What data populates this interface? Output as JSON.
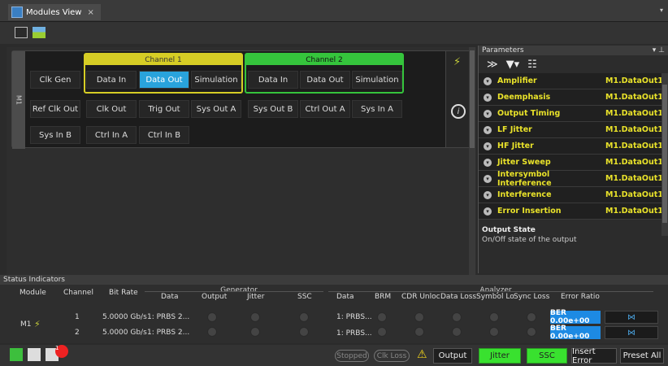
{
  "tab": {
    "title": "Modules View",
    "close": "×"
  },
  "module": {
    "label": "M1",
    "channel1": {
      "title": "Channel 1"
    },
    "channel2": {
      "title": "Channel 2"
    },
    "cells": [
      "Clk Gen",
      "Data In",
      "Data Out",
      "Simulation",
      "Data In",
      "Data Out",
      "Simulation",
      "Ref Clk Out",
      "Clk Out",
      "Trig Out",
      "Sys Out A",
      "Sys Out B",
      "Ctrl Out A",
      "Sys In A",
      "Sys In B",
      "Ctrl In A",
      "Ctrl In B"
    ],
    "info": "i"
  },
  "parameters": {
    "title": "Parameters",
    "rows": [
      {
        "name": "Amplifier",
        "value": "M1.DataOut1"
      },
      {
        "name": "Deemphasis",
        "value": "M1.DataOut1"
      },
      {
        "name": "Output Timing",
        "value": "M1.DataOut1"
      },
      {
        "name": "LF Jitter",
        "value": "M1.DataOut1"
      },
      {
        "name": "HF Jitter",
        "value": "M1.DataOut1"
      },
      {
        "name": "Jitter Sweep",
        "value": "M1.DataOut1"
      },
      {
        "name": "Intersymbol Interference",
        "value": "M1.DataOut1"
      },
      {
        "name": "Interference",
        "value": "M1.DataOut1"
      },
      {
        "name": "Error Insertion",
        "value": "M1.DataOut1"
      }
    ],
    "desc_title": "Output State",
    "desc_text": "On/Off state of the output"
  },
  "status": {
    "title": "Status Indicators",
    "generator_label": "Generator",
    "analyzer_label": "Analyzer",
    "headers": {
      "module": "Module",
      "channel": "Channel",
      "bitrate": "Bit Rate",
      "data": "Data",
      "output": "Output",
      "jitter": "Jitter",
      "ssc": "SSC",
      "adata": "Data",
      "brm": "BRM",
      "cdr": "CDR Unloc",
      "dataloss": "Data Loss",
      "symloss": "Symbol Lo",
      "syncloss": "Sync Loss",
      "ber": "Error Ratio"
    },
    "module_name": "M1",
    "rows": [
      {
        "channel": "1",
        "bitrate": "5.0000 Gb/s",
        "gen_data": "1: PRBS 2...",
        "an_data": "1: PRBS...",
        "ber": "BER 0.00e+00"
      },
      {
        "channel": "2",
        "bitrate": "5.0000 Gb/s",
        "gen_data": "1: PRBS 2...",
        "an_data": "1: PRBS...",
        "ber": "BER 0.00e+00"
      }
    ]
  },
  "bottombar": {
    "badge": "1",
    "stopped": "Stopped",
    "clk_loss": "Clk Loss",
    "output": "Output",
    "jitter": "Jitter",
    "ssc": "SSC",
    "insert_error": "Insert Error",
    "preset_all": "Preset All"
  },
  "colors": {
    "channel1": "#d6cd25",
    "channel2": "#35c43c",
    "selected": "#29a3dc",
    "param_text": "#e9e22a",
    "ber_bg": "#1d8ae3",
    "active_green": "#39e12f"
  }
}
